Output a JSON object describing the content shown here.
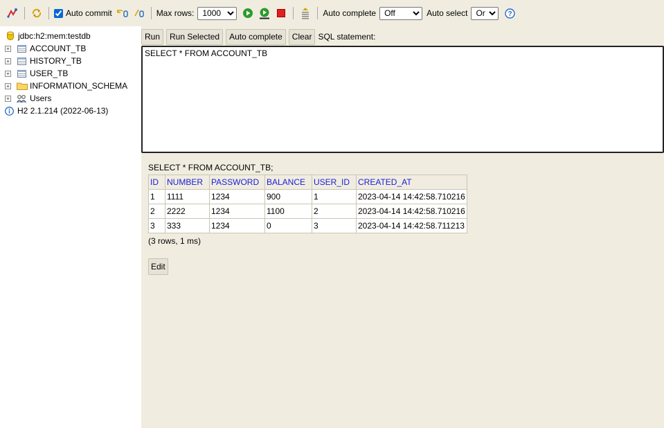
{
  "toolbar": {
    "auto_commit_label": "Auto commit",
    "auto_commit_checked": true,
    "max_rows_label": "Max rows:",
    "max_rows_value": "1000",
    "auto_complete_label": "Auto complete",
    "auto_complete_value": "Off",
    "auto_select_label": "Auto select",
    "auto_select_value": "On",
    "icons": [
      "disconnect-icon",
      "refresh-icon",
      "rollback-icon",
      "commit-icon",
      "run-icon",
      "run-selected-icon",
      "stop-icon",
      "history-icon",
      "help-icon"
    ]
  },
  "tree": {
    "connection": "jdbc:h2:mem:testdb",
    "items": [
      {
        "label": "ACCOUNT_TB",
        "icon": "table-icon"
      },
      {
        "label": "HISTORY_TB",
        "icon": "table-icon"
      },
      {
        "label": "USER_TB",
        "icon": "table-icon"
      },
      {
        "label": "INFORMATION_SCHEMA",
        "icon": "folder-icon"
      },
      {
        "label": "Users",
        "icon": "users-icon"
      }
    ],
    "version": "H2 2.1.214 (2022-06-13)"
  },
  "query": {
    "buttons": {
      "run": "Run",
      "run_selected": "Run Selected",
      "auto_complete": "Auto complete",
      "clear": "Clear"
    },
    "sql_label": "SQL statement:",
    "sql_text": "SELECT * FROM ACCOUNT_TB"
  },
  "result": {
    "statement": "SELECT * FROM ACCOUNT_TB;",
    "columns": [
      "ID",
      "NUMBER",
      "PASSWORD",
      "BALANCE",
      "USER_ID",
      "CREATED_AT"
    ],
    "rows": [
      [
        "1",
        "1111",
        "1234",
        "900",
        "1",
        "2023-04-14 14:42:58.710216"
      ],
      [
        "2",
        "2222",
        "1234",
        "1100",
        "2",
        "2023-04-14 14:42:58.710216"
      ],
      [
        "3",
        "333",
        "1234",
        "0",
        "3",
        "2023-04-14 14:42:58.711213"
      ]
    ],
    "summary": "(3 rows, 1 ms)",
    "edit_label": "Edit"
  },
  "colors": {
    "panel_bg": "#f0ede0",
    "header_text": "#1b1bd8",
    "run_green": "#2e9a2e",
    "stop_red": "#e02020"
  }
}
